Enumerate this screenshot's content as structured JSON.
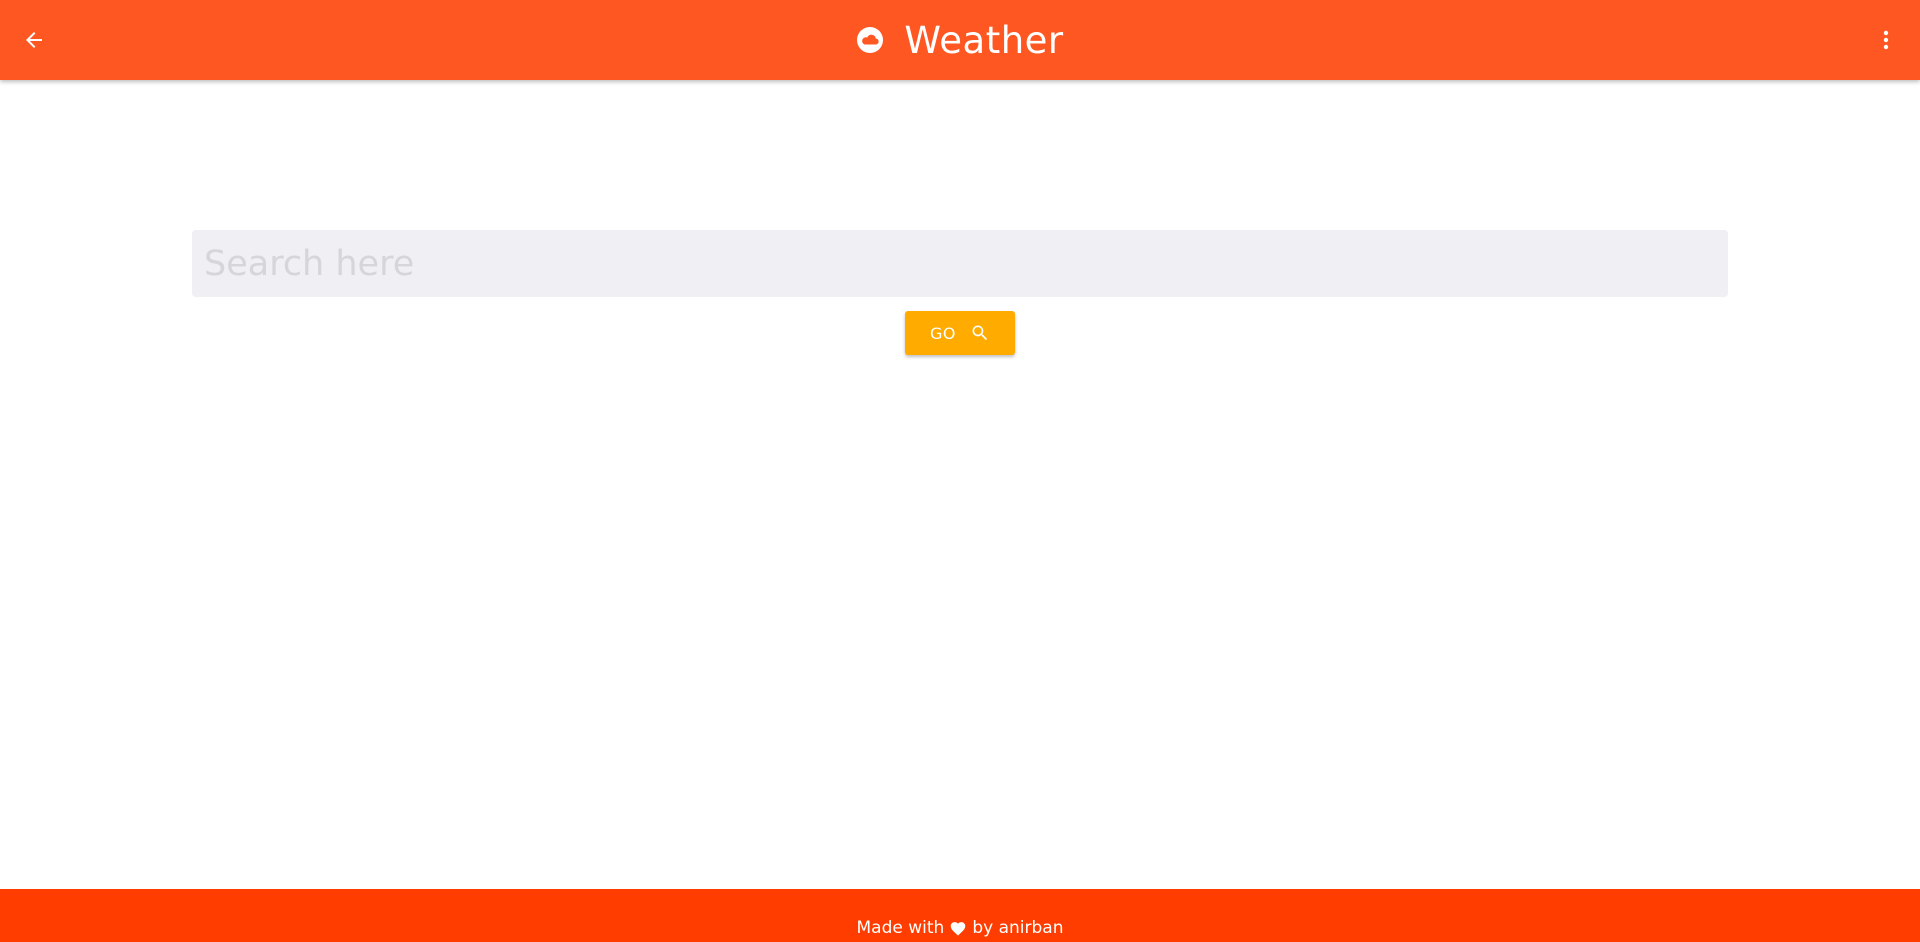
{
  "header": {
    "back_icon": "arrow-left-icon",
    "title_icon": "cloud-icon",
    "title": "Weather",
    "menu_icon": "more-vertical-icon",
    "color": "#ff5722"
  },
  "search": {
    "placeholder": "Search here",
    "value": "",
    "go_label": "GO",
    "go_icon": "search-icon",
    "button_color": "#ffab00"
  },
  "footer": {
    "text_before": "Made with",
    "heart_icon": "heart-icon",
    "text_after": "by anirban",
    "color": "#ff3d00"
  }
}
